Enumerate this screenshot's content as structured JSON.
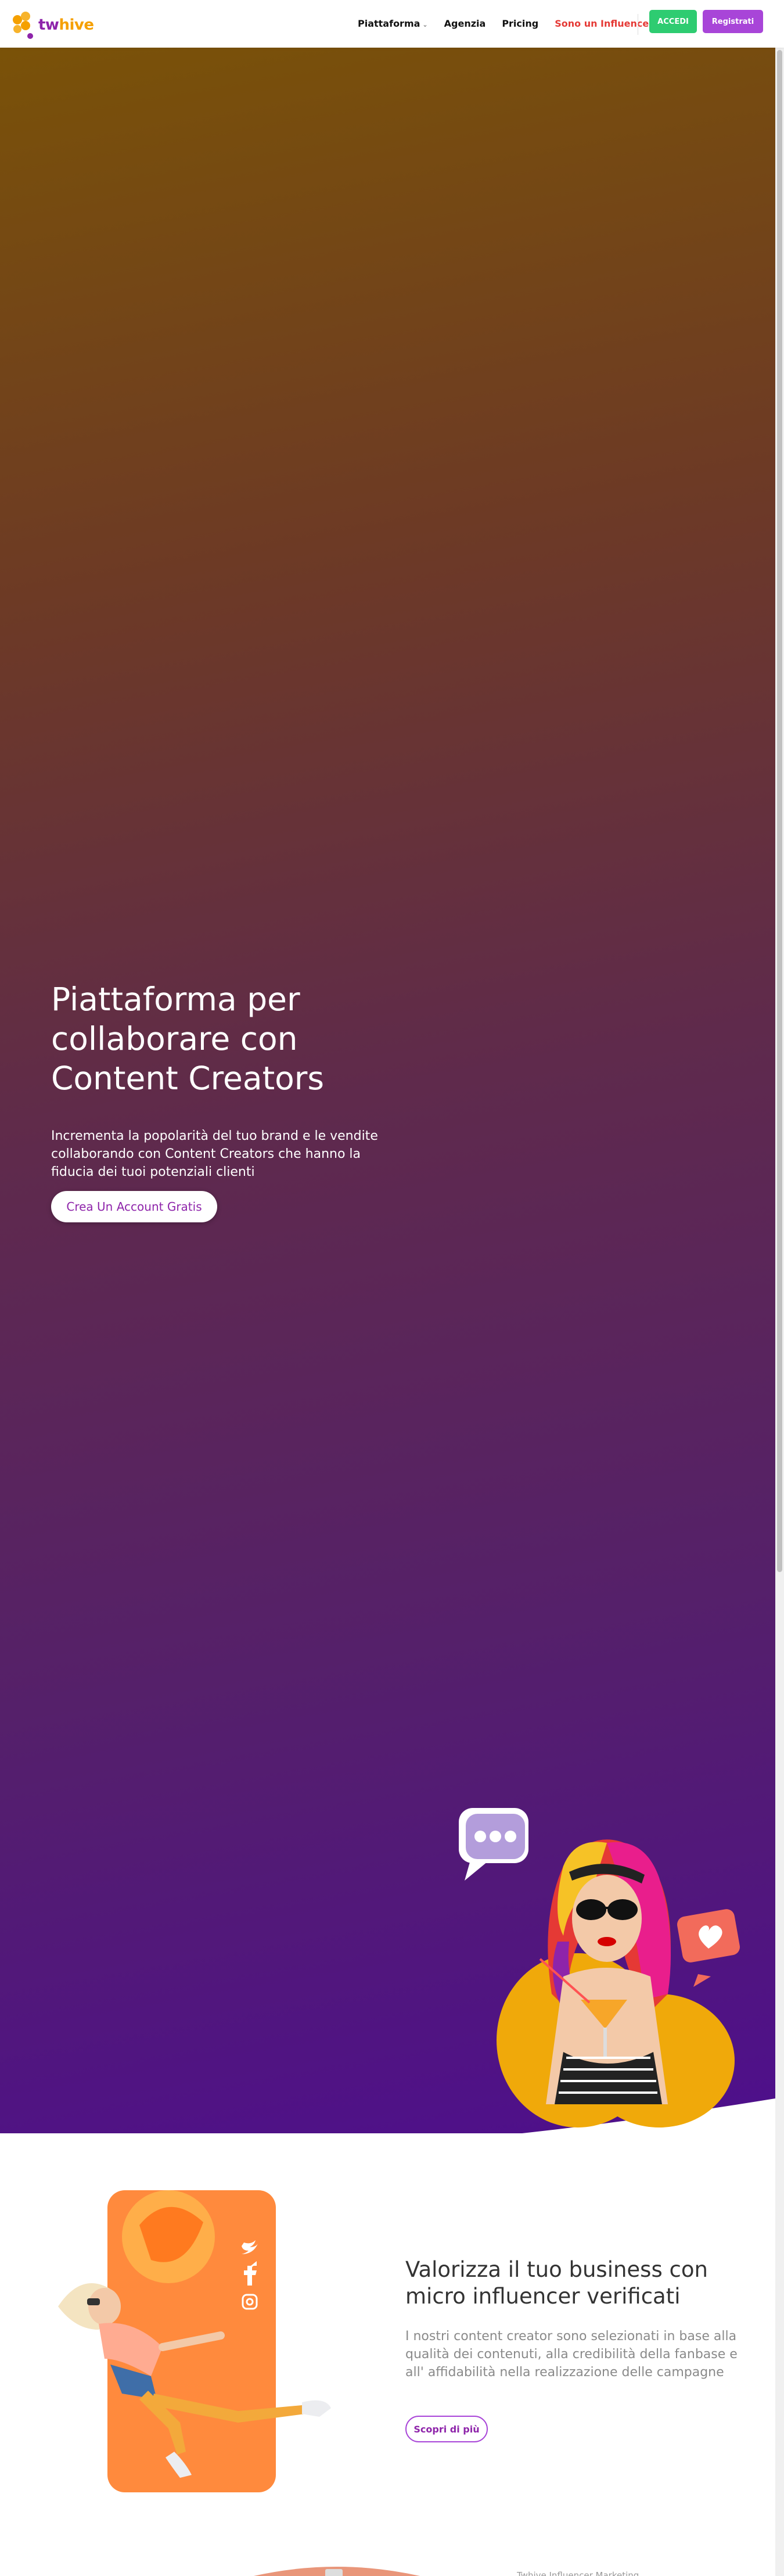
{
  "nav": {
    "logo": {
      "tw": "tw",
      "hive": "hive"
    },
    "links": [
      {
        "label": "Piattaforma",
        "has_dropdown": true
      },
      {
        "label": "Agenzia"
      },
      {
        "label": "Pricing"
      },
      {
        "label": "Sono un Influencer",
        "highlight": true
      }
    ],
    "login_label": "ACCEDI",
    "register_label": "Registrati"
  },
  "hero": {
    "title": "Piattaforma per collaborare con Content Creators",
    "subtitle": "Incrementa la popolarità del tuo brand e le vendite collaborando con Content Creators che hanno la fiducia dei tuoi potenziali clienti",
    "cta_label": "Crea Un Account Gratis",
    "illustration_icons": [
      "chat-bubble-icon",
      "heart-icon"
    ]
  },
  "feature": {
    "title": "Valorizza il tuo business con micro influencer verificati",
    "text": "I nostri content creator sono selezionati in base alla qualità dei contenuti, alla credibilità della fanbase e all' affidabilità nella realizzazione delle campagne",
    "button_label": "Scopri di più",
    "social_icons": [
      "twitter-icon",
      "facebook-icon",
      "instagram-icon"
    ]
  },
  "next_section": {
    "label_cutoff": "Twhive Influencer Marketing"
  },
  "colors": {
    "brand_purple": "#8e24aa",
    "brand_orange": "#f5a000",
    "accedi_green": "#2ecc71",
    "register_purple": "#a845d8",
    "influencer_red": "#e53935"
  }
}
